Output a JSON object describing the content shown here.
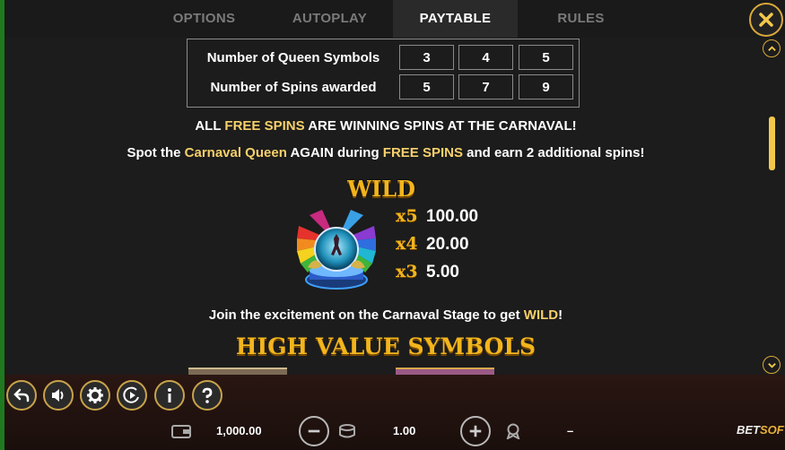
{
  "tabs": [
    {
      "label": "OPTIONS"
    },
    {
      "label": "AUTOPLAY"
    },
    {
      "label": "PAYTABLE"
    },
    {
      "label": "RULES"
    }
  ],
  "queen_table": {
    "rows": [
      {
        "label": "Number of Queen Symbols",
        "values": [
          "3",
          "4",
          "5"
        ]
      },
      {
        "label": "Number of Spins awarded",
        "values": [
          "5",
          "7",
          "9"
        ]
      }
    ]
  },
  "free_spins_line": {
    "p1": "ALL ",
    "h1": "FREE SPINS",
    "p2": " ARE WINNING SPINS AT THE CARNAVAL!"
  },
  "queen_line": {
    "p1": "Spot the ",
    "h1": "Carnaval Queen",
    "p2": " AGAIN during ",
    "h2": "FREE SPINS",
    "p3": " and earn 2 additional spins!"
  },
  "wild": {
    "title": "WILD",
    "payouts": [
      {
        "mult": "x5",
        "value": "100.00"
      },
      {
        "mult": "x4",
        "value": "20.00"
      },
      {
        "mult": "x3",
        "value": "5.00"
      }
    ]
  },
  "stage_line": {
    "p1": "Join the excitement on the Carnaval Stage to get ",
    "h1": "WILD",
    "p2": "!"
  },
  "high_value_title": "HIGH VALUE SYMBOLS",
  "bottom": {
    "balance": "1,000.00",
    "bet": "1.00",
    "win": "–",
    "logo_a": "BET",
    "logo_b": "SOFT"
  },
  "colors": {
    "accent": "#f2b51d",
    "highlight_text": "#f6d06a",
    "frame_gold": "#d9a93a"
  },
  "icons": [
    "close-icon",
    "chevron-up-icon",
    "chevron-down-icon",
    "back-icon",
    "sound-icon",
    "gear-icon",
    "autoplay-icon",
    "info-icon",
    "help-icon",
    "wallet-icon",
    "minus-icon",
    "coins-icon",
    "plus-icon",
    "award-icon"
  ]
}
